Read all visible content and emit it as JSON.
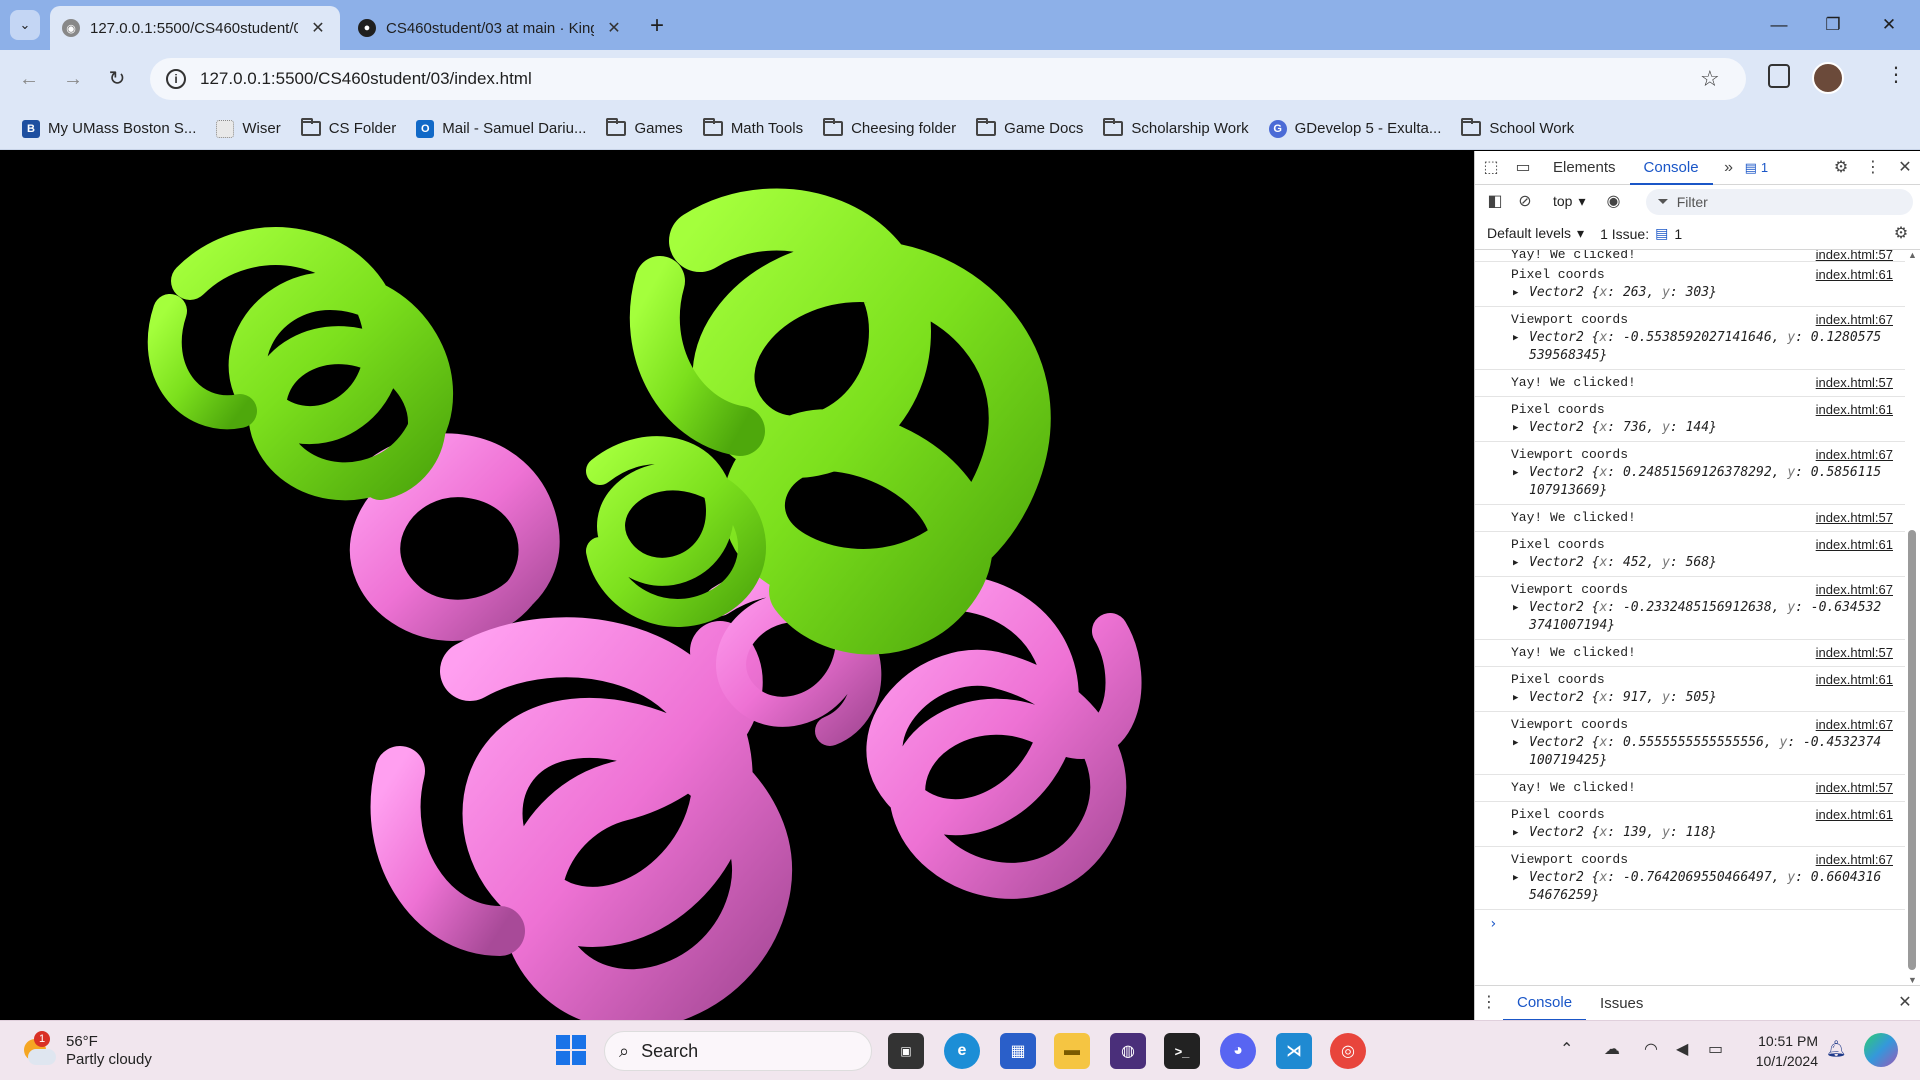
{
  "tabs": [
    {
      "title": "127.0.0.1:5500/CS460student/0",
      "active": true
    },
    {
      "title": "CS460student/03 at main · King",
      "active": false
    }
  ],
  "address": {
    "url": "127.0.0.1:5500/CS460student/03/index.html"
  },
  "bookmarks": [
    {
      "label": "My UMass Boston S...",
      "icon": "umass-b-icon"
    },
    {
      "label": "Wiser",
      "icon": "wiser-icon"
    },
    {
      "label": "CS Folder",
      "icon": "folder-icon"
    },
    {
      "label": "Mail - Samuel Dariu...",
      "icon": "outlook-icon"
    },
    {
      "label": "Games",
      "icon": "folder-icon"
    },
    {
      "label": "Math Tools",
      "icon": "folder-icon"
    },
    {
      "label": "Cheesing folder",
      "icon": "folder-icon"
    },
    {
      "label": "Game Docs",
      "icon": "folder-icon"
    },
    {
      "label": "Scholarship Work",
      "icon": "folder-icon"
    },
    {
      "label": "GDevelop 5 - Exulta...",
      "icon": "gdevelop-icon"
    },
    {
      "label": "School Work",
      "icon": "folder-icon"
    }
  ],
  "scene": {
    "knot_colors": {
      "green": "#7de81f",
      "pink": "#f07ad8"
    }
  },
  "devtools": {
    "tabs": {
      "elements": "Elements",
      "console": "Console",
      "issues_badge": "1"
    },
    "context": "top",
    "filter_placeholder": "Filter",
    "levels": "Default levels",
    "issues": {
      "label": "1 Issue:",
      "count": "1"
    },
    "console_partial": "Yay! We clicked!",
    "console_partial_src": "index.html:57",
    "messages": [
      {
        "text": "Pixel coords",
        "src": "index.html:61",
        "obj": {
          "x": "263",
          "y": "303"
        }
      },
      {
        "text": "Viewport coords",
        "src": "index.html:67",
        "obj": {
          "x": "-0.5538592027141646",
          "y": "0.1280575539568345"
        }
      },
      {
        "text": "Yay! We clicked!",
        "src": "index.html:57"
      },
      {
        "text": "Pixel coords",
        "src": "index.html:61",
        "obj": {
          "x": "736",
          "y": "144"
        }
      },
      {
        "text": "Viewport coords",
        "src": "index.html:67",
        "obj": {
          "x": "0.24851569126378292",
          "y": "0.5856115107913669"
        }
      },
      {
        "text": "Yay! We clicked!",
        "src": "index.html:57"
      },
      {
        "text": "Pixel coords",
        "src": "index.html:61",
        "obj": {
          "x": "452",
          "y": "568"
        }
      },
      {
        "text": "Viewport coords",
        "src": "index.html:67",
        "obj": {
          "x": "-0.2332485156912638",
          "y": "-0.6345323741007194"
        }
      },
      {
        "text": "Yay! We clicked!",
        "src": "index.html:57"
      },
      {
        "text": "Pixel coords",
        "src": "index.html:61",
        "obj": {
          "x": "917",
          "y": "505"
        }
      },
      {
        "text": "Viewport coords",
        "src": "index.html:67",
        "obj": {
          "x": "0.5555555555555556",
          "y": "-0.4532374100719425"
        }
      },
      {
        "text": "Yay! We clicked!",
        "src": "index.html:57"
      },
      {
        "text": "Pixel coords",
        "src": "index.html:61",
        "obj": {
          "x": "139",
          "y": "118"
        }
      },
      {
        "text": "Viewport coords",
        "src": "index.html:67",
        "obj": {
          "x": "-0.7642069550466497",
          "y": "0.660431654676259"
        }
      }
    ],
    "drawer": {
      "console": "Console",
      "issues": "Issues"
    }
  },
  "taskbar": {
    "weather": {
      "temp": "56°F",
      "desc": "Partly cloudy",
      "badge": "1"
    },
    "search": "Search",
    "time": "10:51 PM",
    "date": "10/1/2024"
  }
}
